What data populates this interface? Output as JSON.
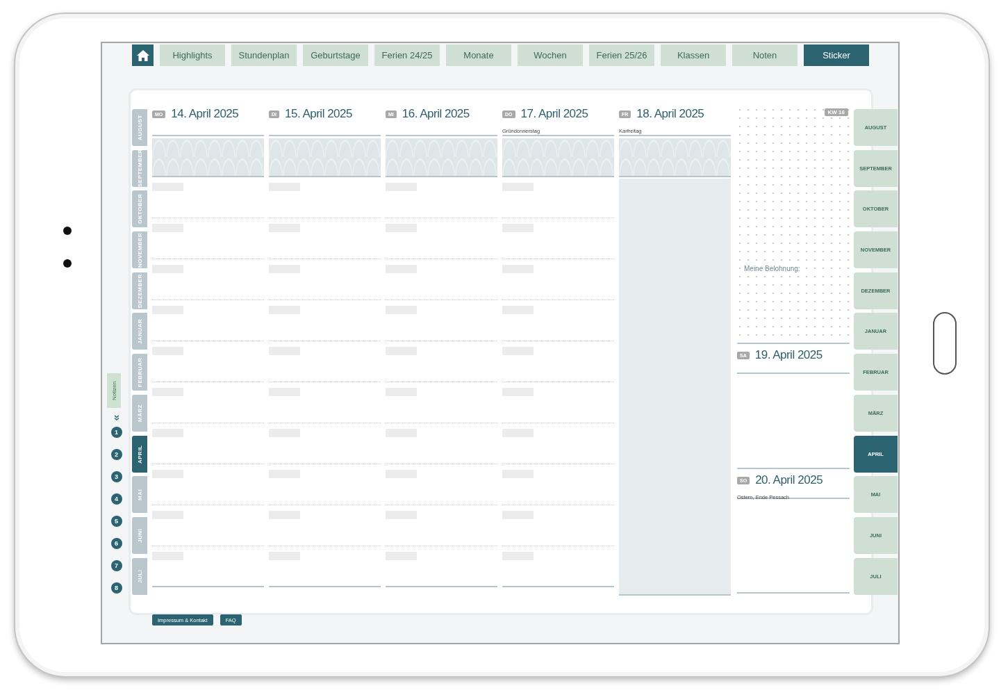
{
  "nav": {
    "tabs": [
      {
        "label": "Highlights",
        "selected": false
      },
      {
        "label": "Stundenplan",
        "selected": false
      },
      {
        "label": "Geburtstage",
        "selected": false
      },
      {
        "label": "Ferien 24/25",
        "selected": false
      },
      {
        "label": "Monate",
        "selected": false
      },
      {
        "label": "Wochen",
        "selected": false
      },
      {
        "label": "Ferien 25/26",
        "selected": false
      },
      {
        "label": "Klassen",
        "selected": false
      },
      {
        "label": "Noten",
        "selected": false
      },
      {
        "label": "Sticker",
        "selected": true
      }
    ]
  },
  "side": {
    "notes_tab": "Notizen",
    "pages": [
      "1",
      "2",
      "3",
      "4",
      "5",
      "6",
      "7",
      "8"
    ]
  },
  "left_months": [
    {
      "label": "AUGUST",
      "selected": false
    },
    {
      "label": "SEPTEMBER",
      "selected": false
    },
    {
      "label": "OKTOBER",
      "selected": false
    },
    {
      "label": "NOVEMBER",
      "selected": false
    },
    {
      "label": "DEZEMBER",
      "selected": false
    },
    {
      "label": "JANUAR",
      "selected": false
    },
    {
      "label": "FEBRUAR",
      "selected": false
    },
    {
      "label": "MÄRZ",
      "selected": false
    },
    {
      "label": "APRIL",
      "selected": true
    },
    {
      "label": "MAI",
      "selected": false
    },
    {
      "label": "JUNI",
      "selected": false
    },
    {
      "label": "JULI",
      "selected": false
    }
  ],
  "week": {
    "kw": "KW 16",
    "reward_label": "Meine Belohnung:",
    "days": [
      {
        "abbr": "MO",
        "date": "14. April 2025",
        "shaded": false
      },
      {
        "abbr": "DI",
        "date": "15. April 2025",
        "shaded": false
      },
      {
        "abbr": "MI",
        "date": "16. April 2025",
        "shaded": false
      },
      {
        "abbr": "DO",
        "date": "17. April 2025",
        "holiday": "Gründonnerstag",
        "shaded": false
      },
      {
        "abbr": "FR",
        "date": "18. April 2025",
        "holiday": "Karfreitag",
        "shaded": true
      }
    ],
    "weekend": [
      {
        "abbr": "SA",
        "date": "19. April 2025"
      },
      {
        "abbr": "SO",
        "date": "20. April 2025",
        "holiday": "Ostern, Ende Pessach"
      }
    ]
  },
  "right_months": [
    {
      "label": "AUGUST",
      "selected": false
    },
    {
      "label": "SEPTEMBER",
      "selected": false
    },
    {
      "label": "OKTOBER",
      "selected": false
    },
    {
      "label": "NOVEMBER",
      "selected": false
    },
    {
      "label": "DEZEMBER",
      "selected": false
    },
    {
      "label": "JANUAR",
      "selected": false
    },
    {
      "label": "FEBRUAR",
      "selected": false
    },
    {
      "label": "MÄRZ",
      "selected": false
    },
    {
      "label": "APRIL",
      "selected": true
    },
    {
      "label": "MAI",
      "selected": false
    },
    {
      "label": "JUNI",
      "selected": false
    },
    {
      "label": "JULI",
      "selected": false
    }
  ],
  "footer_links": [
    "Impressum & Kontakt",
    "FAQ"
  ]
}
